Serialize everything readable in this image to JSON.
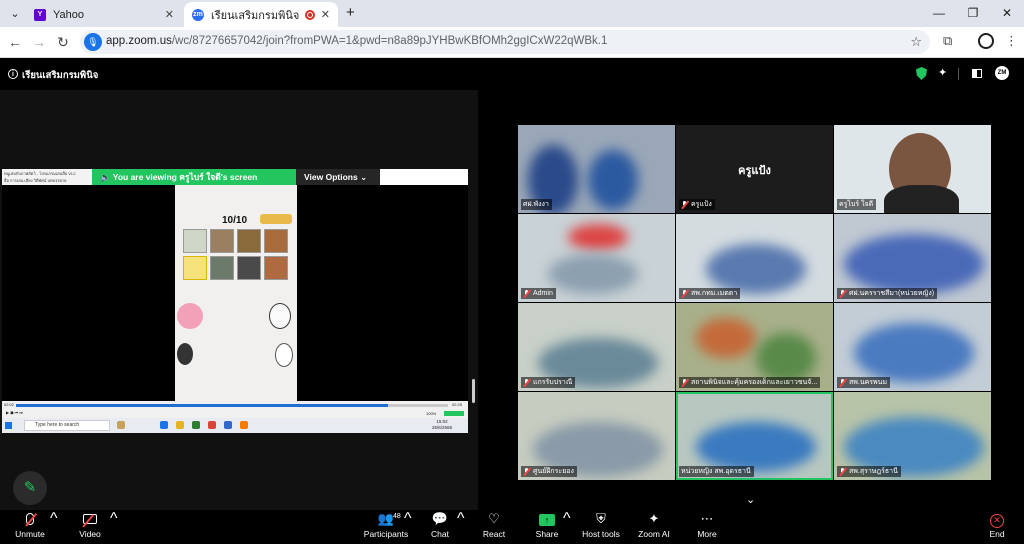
{
  "browser": {
    "tabs": [
      {
        "title": "Yahoo",
        "favicon": "yahoo-icon",
        "active": false
      },
      {
        "title": "เรียนเสริมกรมพินิจ",
        "favicon": "zoom-icon",
        "active": true,
        "recording": true
      }
    ],
    "url_main": "app.zoom.us",
    "url_rest": "/wc/87276657042/join?fromPWA=1&pwd=n8a89pJYHBwKBfOMh2ggICxW22qWBk.1"
  },
  "meeting": {
    "title": "เรียนเสริมกรมพินิจ"
  },
  "share": {
    "banner": "You are viewing  ครูไบร์ ใจดี's screen",
    "view_options": "View Options",
    "vlc_title": "หนูเล่มกับภาพสัตว์ - โปรแกรมเล่นสื่อ VLC",
    "vlc_menu": "สื่อ   การเล่น   เสียง   วิดีทัศน์   บทบรรยาย",
    "score": "10/10",
    "time_elapsed": "02:02",
    "time_total": "02:25",
    "volume": "100%",
    "search_placeholder": "Type here to search",
    "clock_time": "15:02",
    "clock_date": "25/6/2568"
  },
  "gallery": {
    "tiles": [
      {
        "name": "ศฝ.พังงา",
        "muted": true
      },
      {
        "name": "ครูแป้ง",
        "muted": true,
        "video_off": true,
        "center_name": "ครูแป้ง"
      },
      {
        "name": "ครูไบร์ ใจดี",
        "muted": false
      },
      {
        "name": "Admin",
        "muted": true
      },
      {
        "name": "สพ.กทม.เมตตา",
        "muted": true
      },
      {
        "name": "ศฝ.นครราชสีมา(หน่วยหญิง)",
        "muted": true
      },
      {
        "name": "แกรรับปราณี",
        "muted": true
      },
      {
        "name": "สถานพินิจและคุ้มครองเด็กและเยาวชนจั...",
        "muted": true
      },
      {
        "name": "สพ.นครพนม",
        "muted": true
      },
      {
        "name": "ศูนย์ฝึกระยอง",
        "muted": true
      },
      {
        "name": "หน่วยหญิง สพ.อุดรธานี",
        "muted": true,
        "active_speaker": true
      },
      {
        "name": "สพ.สุราษฎร์ธานี",
        "muted": true
      }
    ]
  },
  "controls": {
    "unmute": "Unmute",
    "video": "Video",
    "participants": "Participants",
    "participants_count": "48",
    "chat": "Chat",
    "react": "React",
    "share": "Share",
    "host_tools": "Host tools",
    "zoom_ai": "Zoom AI",
    "more": "More",
    "end": "End"
  },
  "colors": {
    "accent_green": "#22c55e",
    "mute_red": "#ef4444",
    "zoom_blue": "#2d6cf5"
  }
}
